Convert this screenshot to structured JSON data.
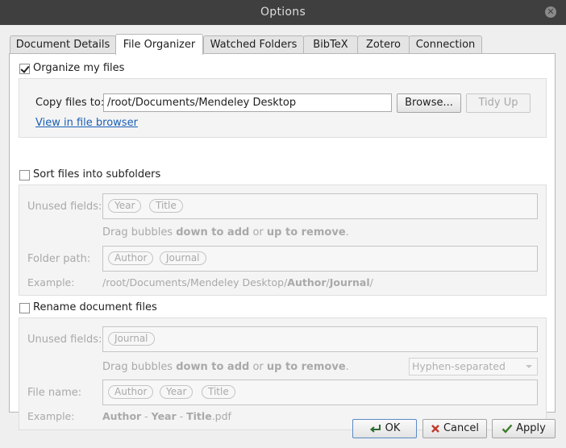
{
  "window": {
    "title": "Options"
  },
  "tabs": [
    {
      "label": "Document Details",
      "active": false
    },
    {
      "label": "File Organizer",
      "active": true
    },
    {
      "label": "Watched Folders",
      "active": false
    },
    {
      "label": "BibTeX",
      "active": false
    },
    {
      "label": "Zotero",
      "active": false
    },
    {
      "label": "Connection",
      "active": false
    }
  ],
  "organize": {
    "label": "Organize my files",
    "checked": true,
    "copy_label": "Copy files to:",
    "path_value": "/root/Documents/Mendeley Desktop",
    "browse_label": "Browse...",
    "tidy_label": "Tidy Up",
    "view_link": "View in file browser"
  },
  "sort": {
    "label": "Sort files into subfolders",
    "checked": false,
    "unused_label": "Unused fields:",
    "unused_bubbles": [
      "Year",
      "Title"
    ],
    "hint_prefix": "Drag bubbles ",
    "hint_add": "down to add",
    "hint_or": " or ",
    "hint_remove": "up to remove",
    "hint_suffix": ".",
    "folder_label": "Folder path:",
    "folder_bubbles": [
      "Author",
      "Journal"
    ],
    "example_label": "Example:",
    "example_prefix": "/root/Documents/Mendeley Desktop/",
    "example_author": "Author",
    "example_sep": "/",
    "example_journal": "Journal",
    "example_trailing": "/"
  },
  "rename": {
    "label": "Rename document files",
    "checked": false,
    "unused_label": "Unused fields:",
    "unused_bubbles": [
      "Journal"
    ],
    "hint_prefix": "Drag bubbles ",
    "hint_add": "down to add",
    "hint_or": " or ",
    "hint_remove": "up to remove",
    "hint_suffix": ".",
    "separator_value": "Hyphen-separated",
    "filename_label": "File name:",
    "filename_bubbles": [
      "Author",
      "Year",
      "Title"
    ],
    "example_label": "Example:",
    "example_author": "Author",
    "example_dash1": " - ",
    "example_year": "Year",
    "example_dash2": " - ",
    "example_title": "Title",
    "example_ext": ".pdf"
  },
  "buttons": {
    "ok": "OK",
    "cancel": "Cancel",
    "apply": "Apply"
  },
  "colors": {
    "titlebar": "#3f3f3f",
    "link": "#1a5fb4",
    "disabled_text": "#a9a9a9"
  }
}
